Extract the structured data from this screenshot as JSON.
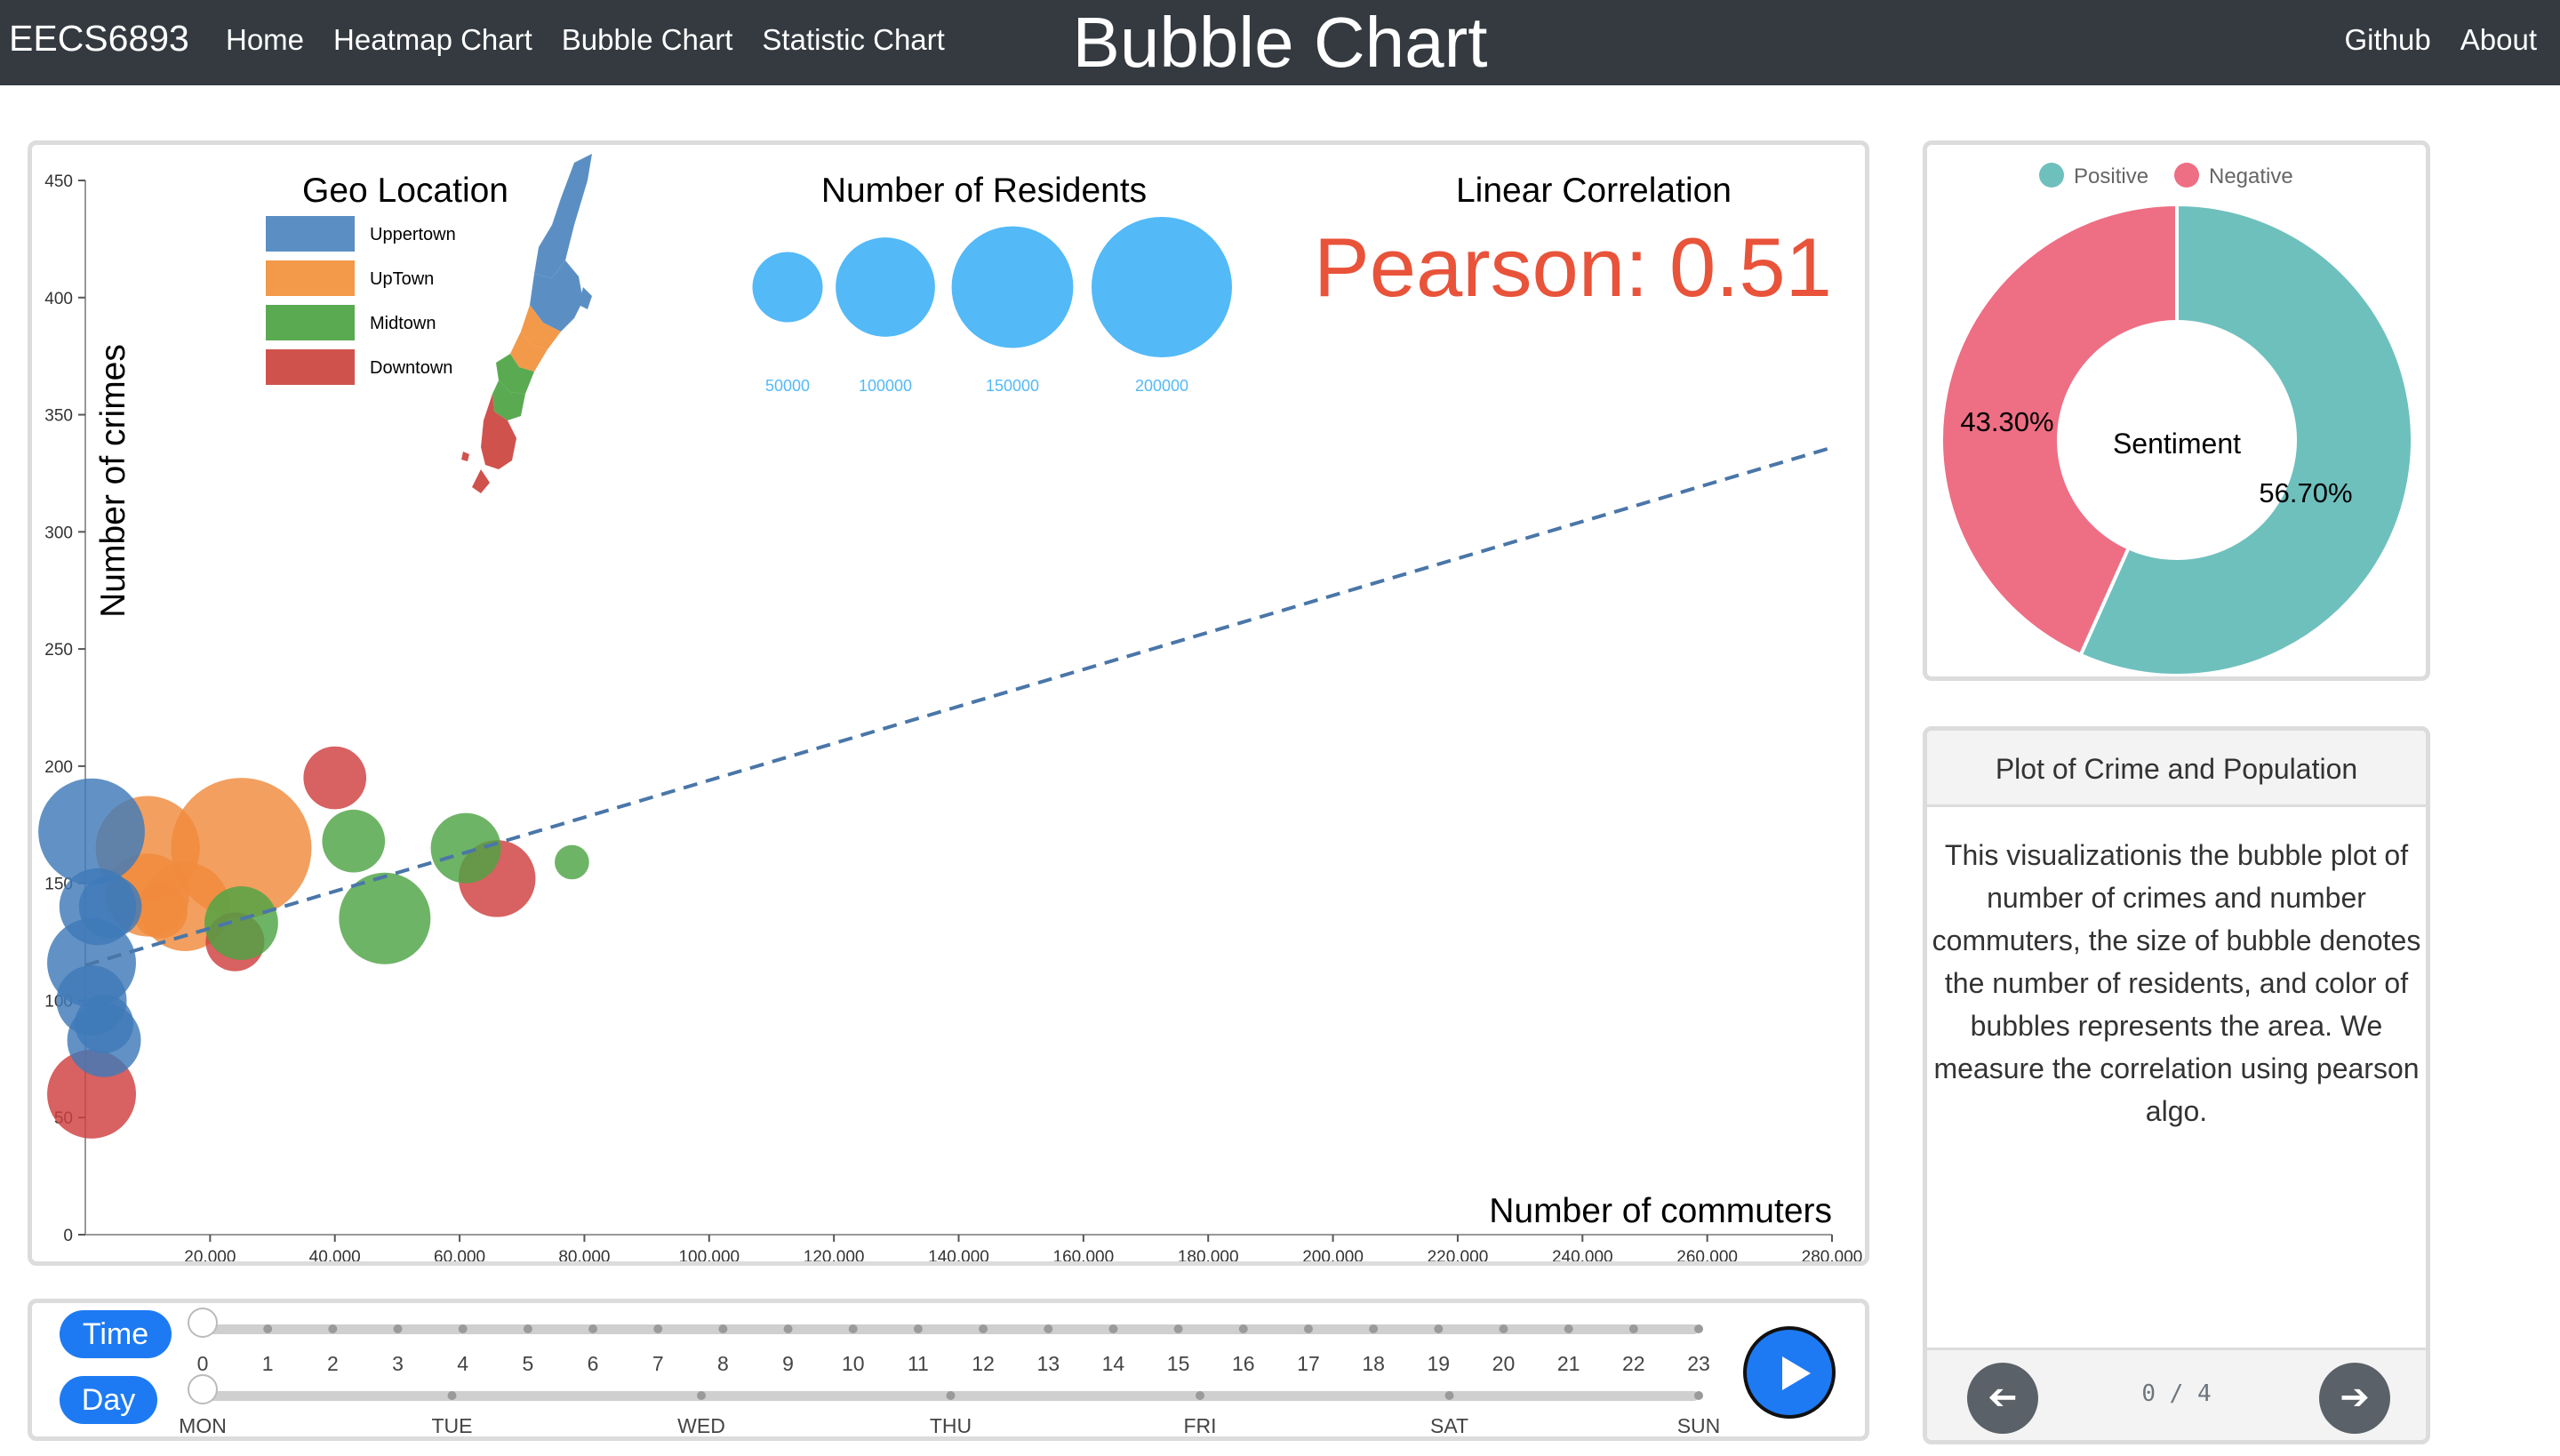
{
  "nav": {
    "brand": "EECS6893",
    "links": [
      "Home",
      "Heatmap Chart",
      "Bubble Chart",
      "Statistic Chart"
    ],
    "title": "Bubble Chart",
    "right_links": [
      "Github",
      "About"
    ]
  },
  "legend": {
    "geo_title": "Geo Location",
    "geo_items": [
      {
        "label": "Uppertown",
        "color": "#5b8fc4"
      },
      {
        "label": "UpTown",
        "color": "#f2994a"
      },
      {
        "label": "Midtown",
        "color": "#5aaa52"
      },
      {
        "label": "Downtown",
        "color": "#d0524d"
      }
    ],
    "residents_title": "Number of Residents",
    "residents_items": [
      "50000",
      "100000",
      "150000",
      "200000"
    ],
    "correlation_title": "Linear Correlation",
    "pearson_label": "Pearson:",
    "pearson_value": "0.51"
  },
  "colors": {
    "Uppertown": "#3f7ab8",
    "UpTown": "#f08a3c",
    "Midtown": "#4ea344",
    "Downtown": "#cf3e3e",
    "accent": "#1d7af3",
    "pearson": "#e8533a",
    "positive": "#6ec0bd",
    "negative": "#ee6e84"
  },
  "chart_data": {
    "type": "scatter",
    "xlabel": "Number of commuters",
    "ylabel": "Number of crimes",
    "xlim": [
      0,
      280000
    ],
    "ylim": [
      0,
      450
    ],
    "xticks": [
      "20,000",
      "40,000",
      "60,000",
      "80,000",
      "100,000",
      "120,000",
      "140,000",
      "160,000",
      "180,000",
      "200,000",
      "220,000",
      "240,000",
      "260,000",
      "280,000"
    ],
    "yticks": [
      "0",
      "50",
      "100",
      "150",
      "200",
      "250",
      "300",
      "350",
      "400",
      "450"
    ],
    "trendline": {
      "x": [
        0,
        280000
      ],
      "y": [
        115,
        336
      ]
    },
    "points": [
      {
        "x": 25000,
        "y": 165,
        "r": 200000,
        "area": "UpTown"
      },
      {
        "x": 10000,
        "y": 165,
        "r": 110000,
        "area": "UpTown"
      },
      {
        "x": 10000,
        "y": 145,
        "r": 70000,
        "area": "UpTown"
      },
      {
        "x": 16000,
        "y": 140,
        "r": 80000,
        "area": "UpTown"
      },
      {
        "x": 12000,
        "y": 138,
        "r": 30000,
        "area": "UpTown"
      },
      {
        "x": 40000,
        "y": 195,
        "r": 40000,
        "area": "Downtown"
      },
      {
        "x": 66000,
        "y": 152,
        "r": 60000,
        "area": "Downtown"
      },
      {
        "x": 24000,
        "y": 125,
        "r": 35000,
        "area": "Downtown"
      },
      {
        "x": 1000,
        "y": 60,
        "r": 80000,
        "area": "Downtown"
      },
      {
        "x": 43000,
        "y": 168,
        "r": 40000,
        "area": "Midtown"
      },
      {
        "x": 61000,
        "y": 165,
        "r": 50000,
        "area": "Midtown"
      },
      {
        "x": 78000,
        "y": 159,
        "r": 12000,
        "area": "Midtown"
      },
      {
        "x": 48000,
        "y": 135,
        "r": 85000,
        "area": "Midtown"
      },
      {
        "x": 25000,
        "y": 133,
        "r": 55000,
        "area": "Midtown"
      },
      {
        "x": 1000,
        "y": 172,
        "r": 115000,
        "area": "Uppertown"
      },
      {
        "x": 2000,
        "y": 140,
        "r": 60000,
        "area": "Uppertown"
      },
      {
        "x": 4000,
        "y": 140,
        "r": 40000,
        "area": "Uppertown"
      },
      {
        "x": 1000,
        "y": 116,
        "r": 80000,
        "area": "Uppertown"
      },
      {
        "x": 1000,
        "y": 100,
        "r": 50000,
        "area": "Uppertown"
      },
      {
        "x": 3000,
        "y": 90,
        "r": 35000,
        "area": "Uppertown"
      },
      {
        "x": 3000,
        "y": 83,
        "r": 55000,
        "area": "Uppertown"
      }
    ]
  },
  "donut": {
    "legend": [
      "Positive",
      "Negative"
    ],
    "center_label": "Sentiment",
    "positive_pct": 56.7,
    "negative_pct": 43.3,
    "positive_label": "56.70%",
    "negative_label": "43.30%"
  },
  "info": {
    "title": "Plot of Crime and Population",
    "body": "This visualizationis the bubble plot of number of crimes and number commuters, the size of bubble denotes the number of residents, and color of bubbles represents the area. We measure the correlation using pearson algo.",
    "pager": "0 / 4",
    "prev_icon": "➔",
    "next_icon": "➔"
  },
  "sliders": {
    "time_label": "Time",
    "day_label": "Day",
    "hours": [
      "0",
      "1",
      "2",
      "3",
      "4",
      "5",
      "6",
      "7",
      "8",
      "9",
      "10",
      "11",
      "12",
      "13",
      "14",
      "15",
      "16",
      "17",
      "18",
      "19",
      "20",
      "21",
      "22",
      "23"
    ],
    "days": [
      "MON",
      "TUE",
      "WED",
      "THU",
      "FRI",
      "SAT",
      "SUN"
    ],
    "time_value": 0,
    "day_value": 0
  }
}
